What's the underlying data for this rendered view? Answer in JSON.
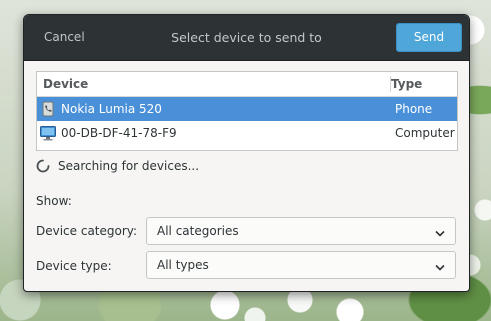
{
  "dialog": {
    "cancel_label": "Cancel",
    "title": "Select device to send to",
    "send_label": "Send"
  },
  "device_list": {
    "columns": [
      "Device",
      "Type"
    ],
    "rows": [
      {
        "device": "Nokia Lumia 520",
        "type": "Phone",
        "icon": "phone-icon",
        "selected": true
      },
      {
        "device": "00-DB-DF-41-78-F9",
        "type": "Computer",
        "icon": "computer-icon",
        "selected": false
      }
    ]
  },
  "status": {
    "searching_text": "Searching for devices...",
    "spinner_icon": "spinner-icon"
  },
  "filters": {
    "show_label": "Show:",
    "category_label": "Device category:",
    "category_value": "All categories",
    "type_label": "Device type:",
    "type_value": "All types"
  },
  "colors": {
    "headerbar": "#2d3335",
    "accent": "#4fa6d9",
    "selection": "#4a90d9"
  }
}
